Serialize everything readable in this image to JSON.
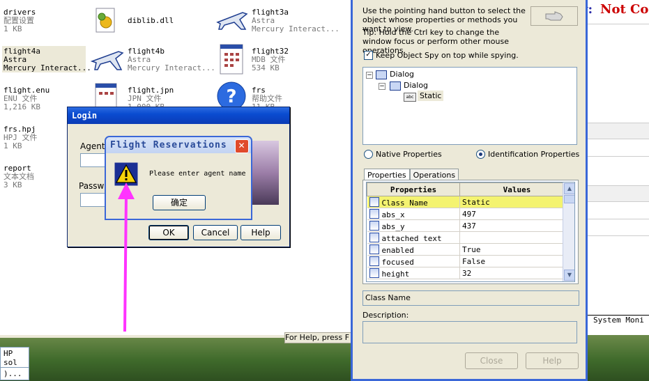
{
  "explorer": {
    "files": [
      {
        "name": "drivers",
        "line2": "配置设置",
        "line3": "1 KB"
      },
      {
        "name": "diblib.dll",
        "line2": "",
        "line3": ""
      },
      {
        "name": "flight3a",
        "line2": "Astra",
        "line3": "Mercury Interact..."
      },
      {
        "name": "flight4a",
        "line2": "Astra",
        "line3": "Mercury Interact..."
      },
      {
        "name": "flight4b",
        "line2": "Astra",
        "line3": "Mercury Interact..."
      },
      {
        "name": "flight32",
        "line2": "MDB 文件",
        "line3": "534 KB"
      },
      {
        "name": "flight.enu",
        "line2": "ENU 文件",
        "line3": "1,216 KB"
      },
      {
        "name": "flight.jpn",
        "line2": "JPN 文件",
        "line3": "1,000 KB"
      },
      {
        "name": "frs",
        "line2": "帮助文件",
        "line3": "11 KB"
      },
      {
        "name": "frs.hpj",
        "line2": "HPJ 文件",
        "line3": "1 KB"
      },
      {
        "name": "report",
        "line2": "文本文档",
        "line3": "3 KB"
      }
    ],
    "status_text": "For Help, press F"
  },
  "taskbar": {
    "item1": "HP sol",
    "item2": ")..."
  },
  "right_app": {
    "heading_partial": "y:",
    "status_partial": "Not Con",
    "tab_partial": "System Moni"
  },
  "login": {
    "title": "Login",
    "agent_label": "Agent N",
    "password_label": "Passwo",
    "ok": "OK",
    "cancel": "Cancel",
    "help": "Help"
  },
  "message": {
    "title": "Flight Reservations",
    "text": "Please enter agent name",
    "ok": "确定"
  },
  "spy": {
    "instruction": "Use the pointing hand button to select the object whose properties or methods you want to view.",
    "tip": "Tip: Hold the Ctrl key to change the window focus or perform other mouse operations.",
    "keep_on_top": "Keep Object Spy on top while spying.",
    "tree": [
      "Dialog",
      "Dialog",
      "Static"
    ],
    "native_label": "Native Properties",
    "ident_label": "Identification Properties",
    "tab_properties": "Properties",
    "tab_operations": "Operations",
    "col_properties": "Properties",
    "col_values": "Values",
    "rows": [
      {
        "prop": "Class Name",
        "val": "Static"
      },
      {
        "prop": "abs_x",
        "val": "497"
      },
      {
        "prop": "abs_y",
        "val": "437"
      },
      {
        "prop": "attached text",
        "val": ""
      },
      {
        "prop": "enabled",
        "val": "True"
      },
      {
        "prop": "focused",
        "val": "False"
      },
      {
        "prop": "height",
        "val": "32"
      }
    ],
    "selected_field": "Class Name",
    "description_label": "Description:",
    "close": "Close",
    "help": "Help"
  },
  "colors": {
    "xp_blue": "#0a4cd1",
    "arrow": "#ff33ff",
    "selected_row": "#f4f370",
    "status_red": "#cc0000"
  }
}
